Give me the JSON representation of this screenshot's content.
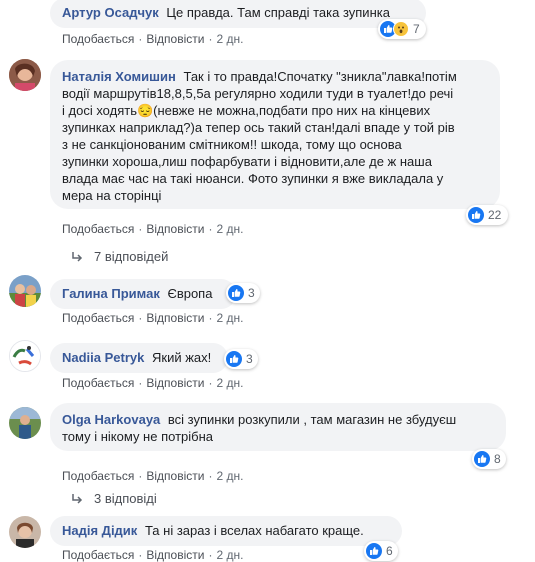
{
  "comments": [
    {
      "author": "Артур Осадчук",
      "text": "Це правда. Там справді така зупинка",
      "actions": {
        "like": "Подобається",
        "reply": "Відповісти",
        "time": "2 дн."
      },
      "reactions": {
        "count": "7",
        "icons": [
          "like-icon",
          "wow-icon"
        ]
      }
    },
    {
      "author": "Наталія Хомишин",
      "text_lines": [
        "Так і то правда!Спочатку \"зникла\"лавка!потім",
        "водії маршрутів18,8,5,5а регулярно ходили туди в туалет!до речі",
        "і досі ходять😔(невже не можна,подбати про них на кінцевих",
        "зупинках наприклад?)а тепер ось такий стан!далі впаде у той рів",
        "з не санкціонованим смітником!! шкода, тому що основа",
        "зупинки хороша,лиш пофарбувати і відновити,але де ж наша",
        "влада має час на такі нюанси. Фото зупинки я вже викладала у",
        "мера на сторінці"
      ],
      "actions": {
        "like": "Подобається",
        "reply": "Відповісти",
        "time": "2 дн."
      },
      "reactions": {
        "count": "22",
        "icons": [
          "like-icon"
        ]
      },
      "replies": "7 відповідей"
    },
    {
      "author": "Галина Примак",
      "text": "Європа",
      "actions": {
        "like": "Подобається",
        "reply": "Відповісти",
        "time": "2 дн."
      },
      "reactions": {
        "count": "3",
        "icons": [
          "like-icon"
        ]
      }
    },
    {
      "author": "Nadiia Petryk",
      "text": "Який жах!",
      "actions": {
        "like": "Подобається",
        "reply": "Відповісти",
        "time": "2 дн."
      },
      "reactions": {
        "count": "3",
        "icons": [
          "like-icon"
        ]
      }
    },
    {
      "author": "Olga Harkovaya",
      "text_line1": "всі зупинки розкупили , там магазин не збудуєш",
      "text_line2": "тому і нікому не потрібна",
      "actions": {
        "like": "Подобається",
        "reply": "Відповісти",
        "time": "2 дн."
      },
      "reactions": {
        "count": "8",
        "icons": [
          "like-icon"
        ]
      },
      "replies": "3 відповіді"
    },
    {
      "author": "Надія Дідик",
      "text": "Та ні зараз і вселах набагато краще.",
      "actions": {
        "like": "Подобається",
        "reply": "Відповісти",
        "time": "2 дн."
      },
      "reactions": {
        "count": "6",
        "icons": [
          "like-icon"
        ]
      }
    }
  ],
  "colors": {
    "link": "#385898",
    "like_blue": "#1877f2",
    "bubble": "#f2f3f5",
    "meta": "#606770"
  }
}
